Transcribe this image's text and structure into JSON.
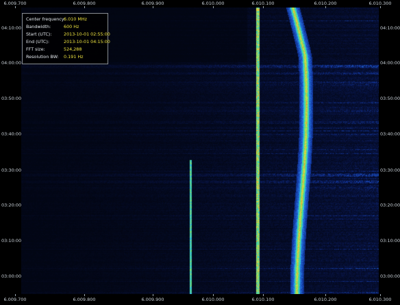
{
  "info_panel": {
    "rows": [
      {
        "label": "Center frequency:",
        "value": "6.010 MHz"
      },
      {
        "label": "Bandwidth:",
        "value": "600 Hz"
      },
      {
        "label": "Start (UTC):",
        "value": "2013-10-01 02:55:00"
      },
      {
        "label": "End (UTC):",
        "value": "2013-10-01 04:15:00"
      },
      {
        "label": "FFT size:",
        "value": "524,288"
      },
      {
        "label": "Resolution BW:",
        "value": "0.191 Hz"
      }
    ]
  },
  "freq_axis": {
    "labels": [
      "6.009.700",
      "6.009.800",
      "6.009.900",
      "6.010.000",
      "6.010.100",
      "6.010.200",
      "6.010.300"
    ]
  },
  "time_axis": {
    "labels": [
      "04:10:00",
      "04:00:00",
      "03:50:00",
      "03:40:00",
      "03:30:00",
      "03:20:00",
      "03:10:00",
      "03:00:00"
    ]
  },
  "colors": {
    "background": "#000000",
    "label_text": "#c9d1d8",
    "info_value": "#f1e640",
    "info_border": "#8a8f94"
  }
}
